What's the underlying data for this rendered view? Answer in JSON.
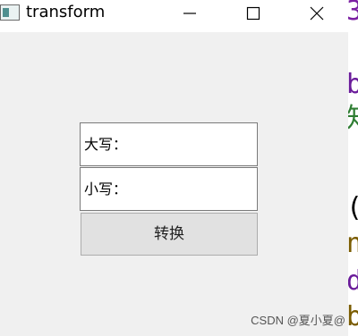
{
  "window": {
    "title": "transform",
    "icon": "app-window-icon",
    "controls": {
      "minimize": "minimize-icon",
      "maximize": "maximize-icon",
      "close": "close-icon"
    }
  },
  "form": {
    "upper_label": "大写：",
    "upper_value": "",
    "lower_label": "小写：",
    "lower_value": "",
    "convert_label": "转换"
  },
  "background": {
    "fragments": [
      {
        "text": "3",
        "color": "#7b1fa2"
      },
      {
        "text": "b",
        "color": "#6a1b9a"
      },
      {
        "text": "知",
        "color": "#2e7d32"
      },
      {
        "text": "(",
        "color": "#000000"
      },
      {
        "text": "n",
        "color": "#7a5c00"
      },
      {
        "text": "d",
        "color": "#6a1b9a"
      },
      {
        "text": "b",
        "color": "#7a5c00"
      }
    ],
    "watermark": "CSDN @夏小夏@"
  }
}
